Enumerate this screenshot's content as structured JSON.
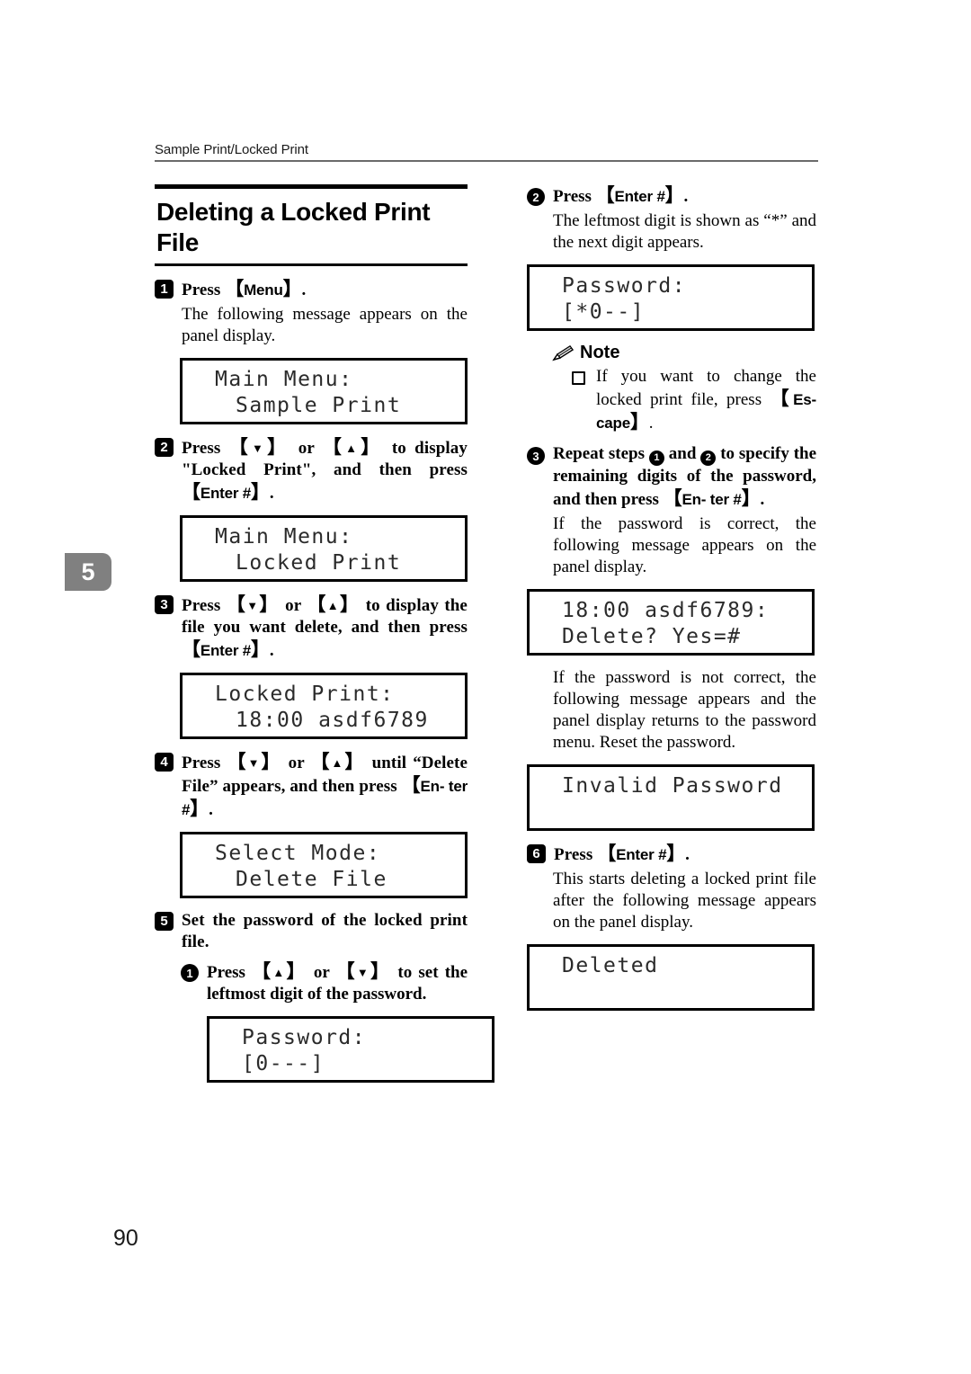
{
  "header": {
    "running_head": "Sample Print/Locked Print",
    "chapter_tab": "5",
    "page_number": "90"
  },
  "section": {
    "title": "Deleting a Locked Print File"
  },
  "left_column": {
    "step1": {
      "number": "1",
      "head_press": "Press",
      "head_key": "Menu",
      "head_tail": ".",
      "body": "The following message appears on the panel display."
    },
    "lcd1": {
      "line1": "Main Menu:",
      "line2": "Sample Print"
    },
    "step2": {
      "number": "2",
      "text_a": "Press",
      "key_down": "▼",
      "text_b": "or",
      "key_up": "▲",
      "text_c": "to display \"Locked Print\", and then press",
      "key_enter": "Enter #",
      "text_d": "."
    },
    "lcd2": {
      "line1": "Main Menu:",
      "line2": "Locked Print"
    },
    "step3": {
      "number": "3",
      "text_a": "Press",
      "key_down": "▼",
      "text_b": "or",
      "key_up": "▲",
      "text_c": "to display the file you want delete, and then press",
      "key_enter": "Enter #",
      "text_d": "."
    },
    "lcd3": {
      "line1": "Locked Print:",
      "line2": "18:00 asdf6789"
    },
    "step4": {
      "number": "4",
      "text_a": "Press",
      "key_down": "▼",
      "text_b": "or",
      "key_up": "▲",
      "text_c": "until “Delete File” appears, and then press",
      "key_enter": "En-\nter #",
      "text_d": "."
    },
    "lcd4": {
      "line1": "Select Mode:",
      "line2": "Delete File"
    },
    "step5": {
      "number": "5",
      "text": "Set the password of the locked print file."
    },
    "substep1": {
      "number": "1",
      "text_a": "Press",
      "key_up": "▲",
      "text_b": "or",
      "key_down": "▼",
      "text_c": "to set the leftmost digit of the password."
    },
    "lcd5": {
      "line1": "Password:",
      "line2": "[0---]"
    }
  },
  "right_column": {
    "substep2": {
      "number": "2",
      "text_a": "Press",
      "key_enter": "Enter #",
      "text_b": ".",
      "body": "The leftmost digit is shown as “*” and the next digit appears."
    },
    "lcd6": {
      "line1": "Password:",
      "line2": "[*0--]"
    },
    "note": {
      "label": "Note",
      "icon": "pencil-icon",
      "item1_a": "If you want to change the locked print file, press",
      "item1_key": "Es-\ncape",
      "item1_b": "."
    },
    "substep3": {
      "number": "3",
      "text_a": "Repeat steps",
      "circ_1": "1",
      "text_b": "and",
      "circ_2": "2",
      "text_c": "to specify the remaining digits of the password, and then press",
      "key_enter": "En-\nter #",
      "text_d": ".",
      "body": "If the password is correct, the following message appears on the panel display."
    },
    "lcd7": {
      "line1": "18:00 asdf6789:",
      "line2": "Delete? Yes=#"
    },
    "body_invalid": "If the password is not correct, the following message appears and the panel display returns to the password menu. Reset the password.",
    "lcd8": {
      "line1": "Invalid Password",
      "line2": ""
    },
    "step6": {
      "number": "6",
      "text_a": "Press",
      "key_enter": "Enter #",
      "text_b": ".",
      "body": "This starts deleting a locked print file after the following message appears on the panel display."
    },
    "lcd9": {
      "line1": "Deleted",
      "line2": ""
    }
  }
}
